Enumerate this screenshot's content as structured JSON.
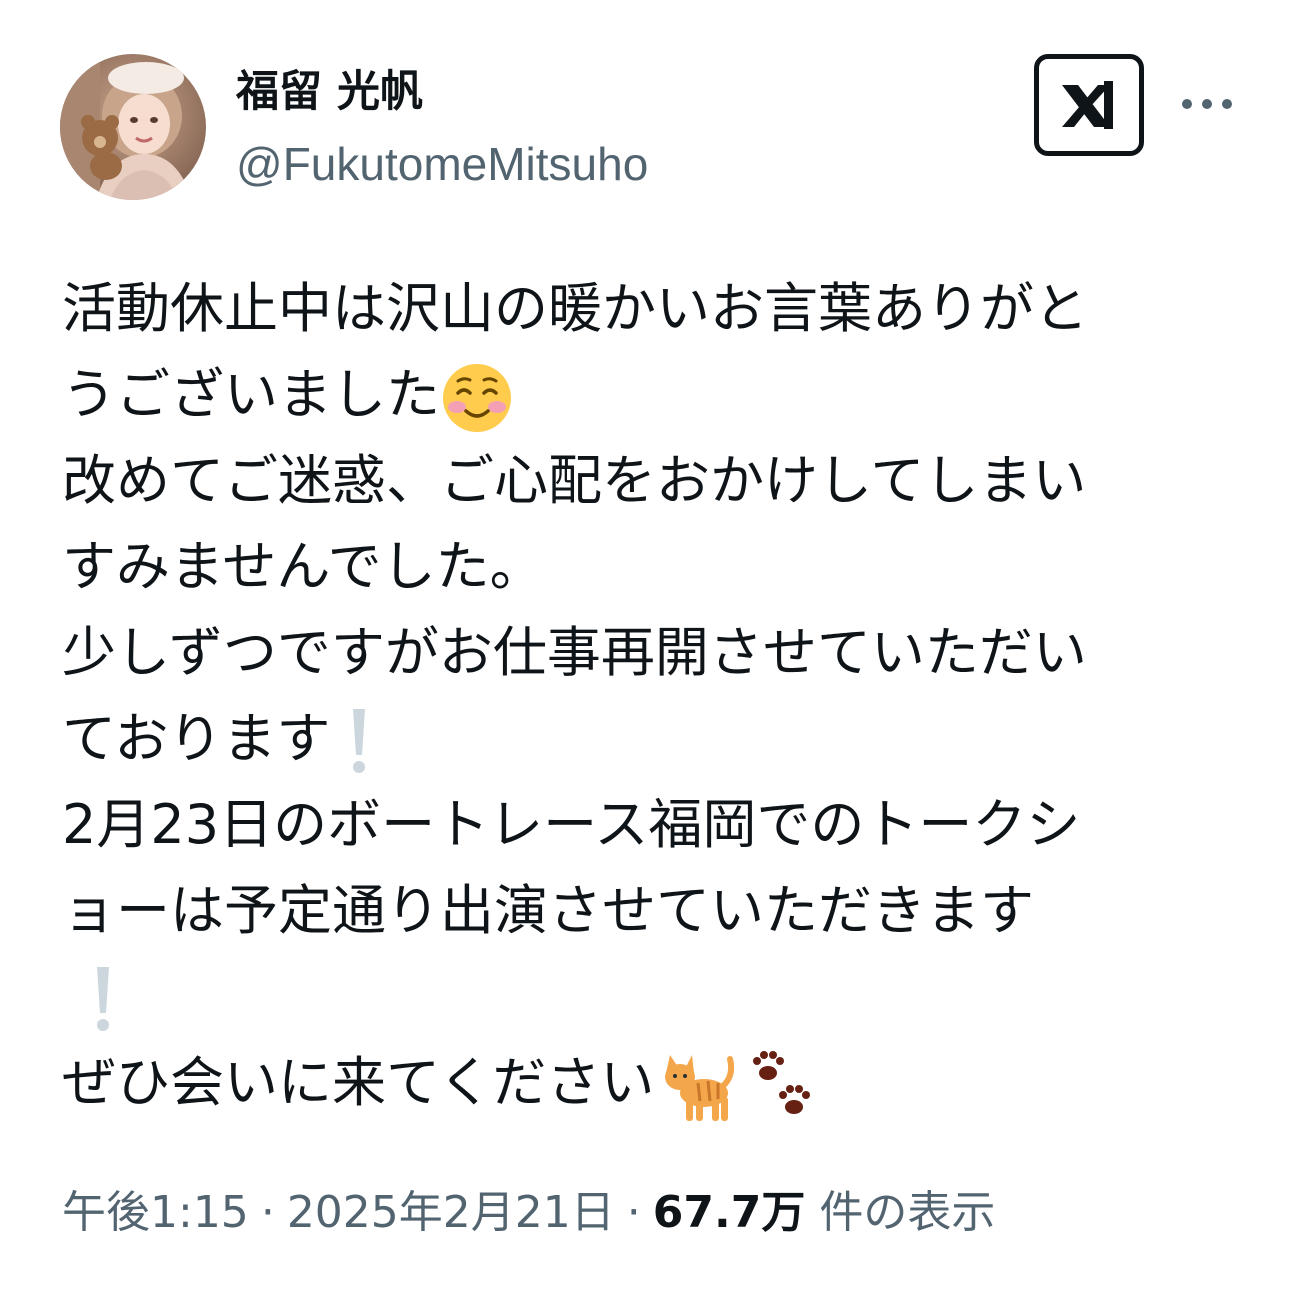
{
  "author": {
    "display_name": "福留 光帆",
    "handle": "@FukutomeMitsuho",
    "avatar_icon": "profile-photo"
  },
  "actions": {
    "grok_icon": "grok-icon",
    "more_icon": "more-options-icon"
  },
  "tweet": {
    "lines": [
      "活動休止中は沢山の暖かいお言葉ありがと",
      "うございました",
      "改めてご迷惑、ご心配をおかけしてしまい",
      "すみませんでした。",
      "少しずつですがお仕事再開させていただい",
      "ております",
      "2月23日のボートレース福岡でのトークシ",
      "ョーは予定通り出演させていただきます",
      "",
      "ぜひ会いに来てください"
    ],
    "emoji": {
      "smiling_face": "smiling-face-with-blush-emoji",
      "exclamation": "white-exclamation-emoji",
      "cat": "cat-emoji",
      "paw_prints": "paw-prints-emoji"
    }
  },
  "meta": {
    "time": "午後1:15",
    "separator": "·",
    "date": "2025年2月21日",
    "views_count": "67.7万",
    "views_label": "件の表示"
  },
  "colors": {
    "text_primary": "#0f1419",
    "text_secondary": "#536471",
    "background": "#ffffff"
  }
}
